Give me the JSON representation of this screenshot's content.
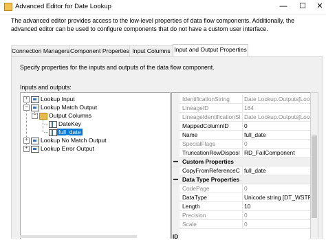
{
  "window": {
    "title": "Advanced Editor for Date Lookup",
    "minimize_glyph": "—",
    "maximize_glyph": "☐",
    "close_glyph": "✕"
  },
  "description": "The advanced editor provides access to the low-level properties of data flow components. Additionally, the advanced editor can be used to configure components that do not have a custom user interface.",
  "tabs": [
    {
      "label": "Connection Managers"
    },
    {
      "label": "Component Properties"
    },
    {
      "label": "Input Columns"
    },
    {
      "label": "Input and Output Properties",
      "active": true
    }
  ],
  "panel": {
    "instructions": "Specify properties for the inputs and outputs of the data flow component.",
    "tree_label": "Inputs and outputs:"
  },
  "tree": {
    "lookup_input": "Lookup Input",
    "lookup_match_output": "Lookup Match Output",
    "output_columns": "Output Columns",
    "date_key": "DateKey",
    "full_date": "full_date",
    "lookup_no_match_output": "Lookup No Match Output",
    "lookup_error_output": "Lookup Error Output"
  },
  "properties": {
    "rows_top": [
      {
        "name": "IdentificationString",
        "value": "Date Lookup.Outputs[Looku",
        "readonly": true
      },
      {
        "name": "LineageID",
        "value": "164",
        "readonly": true
      },
      {
        "name": "LineageIdentificationStr",
        "value": "Date Lookup.Outputs[Looku",
        "readonly": true
      },
      {
        "name": "MappedColumnID",
        "value": "0",
        "readonly": false
      },
      {
        "name": "Name",
        "value": "full_date",
        "readonly": false
      },
      {
        "name": "SpecialFlags",
        "value": "0",
        "readonly": true
      },
      {
        "name": "TruncationRowDisposit",
        "value": "RD_FailComponent",
        "readonly": false
      }
    ],
    "custom_category": "Custom Properties",
    "custom_rows": [
      {
        "name": "CopyFromReferenceCo",
        "value": "full_date",
        "readonly": false
      }
    ],
    "datatype_category": "Data Type Properties",
    "datatype_rows": [
      {
        "name": "CodePage",
        "value": "0",
        "readonly": true
      },
      {
        "name": "DataType",
        "value": "Unicode string [DT_WSTR]",
        "readonly": false
      },
      {
        "name": "Length",
        "value": "10",
        "readonly": false
      },
      {
        "name": "Precision",
        "value": "0",
        "readonly": true
      },
      {
        "name": "Scale",
        "value": "0",
        "readonly": true
      }
    ],
    "bottom_label": "ID"
  }
}
